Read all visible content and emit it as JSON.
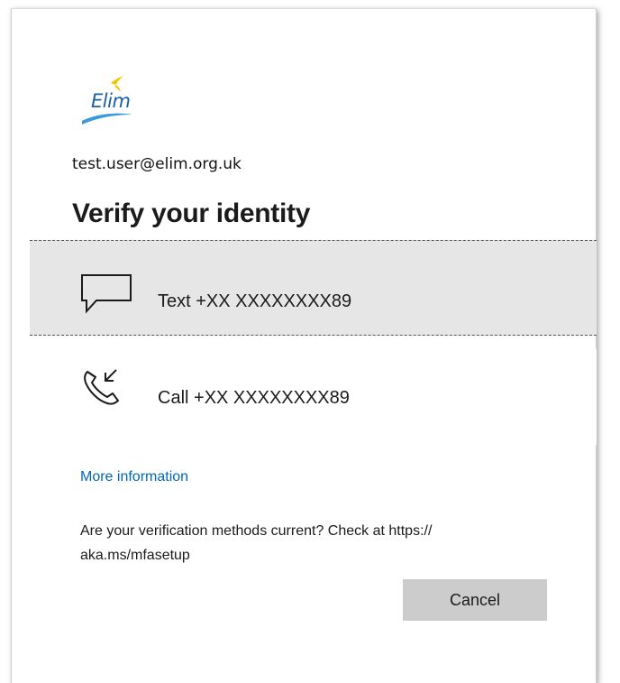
{
  "brand": {
    "logo_text": "Elim",
    "logo_text_color": "#1a5fa8",
    "swoosh_color": "#3a9ad9",
    "accent_bird_color": "#f2c500"
  },
  "account": {
    "email": "test.user@elim.org.uk"
  },
  "header": {
    "title": "Verify your identity"
  },
  "options": [
    {
      "icon": "chat-bubble-icon",
      "label": "Text +XX XXXXXXXX89",
      "selected": true
    },
    {
      "icon": "phone-call-icon",
      "label": "Call +XX XXXXXXXX89",
      "selected": false
    }
  ],
  "links": {
    "more_info": "More information"
  },
  "notice": {
    "line1": "Are your verification methods current? Check at https://",
    "line2": "aka.ms/mfasetup"
  },
  "actions": {
    "cancel_label": "Cancel"
  },
  "colors": {
    "link": "#0067b8",
    "selected_bg": "#e6e6e6",
    "button_bg": "#cccccc"
  }
}
